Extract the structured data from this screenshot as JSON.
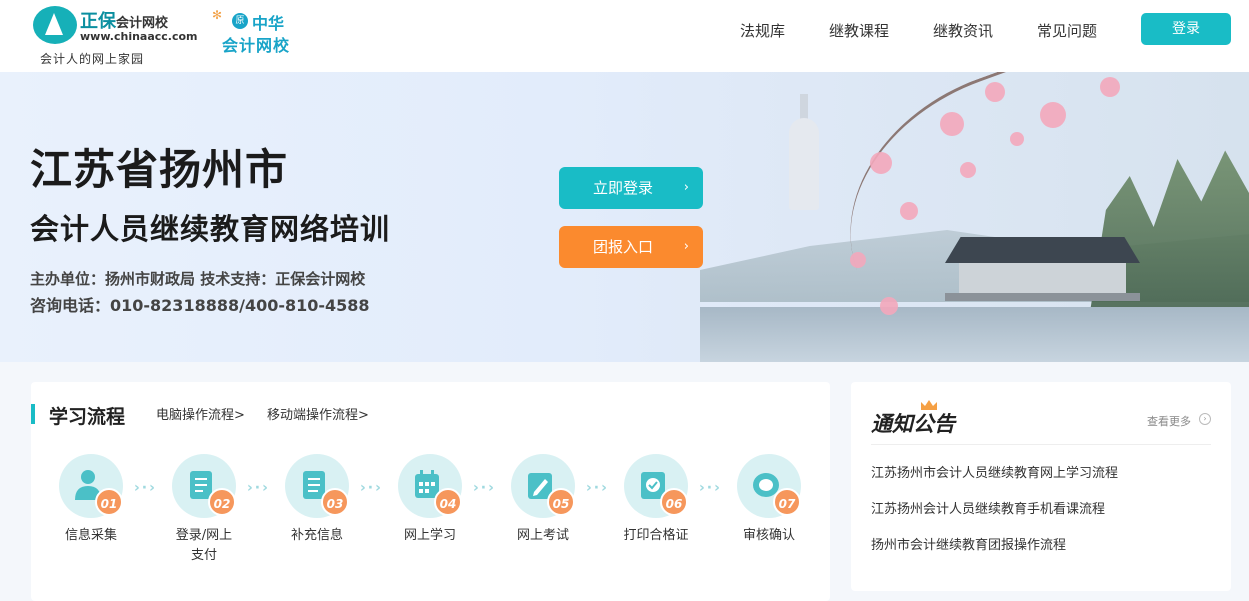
{
  "header": {
    "logo1": {
      "name": "正保",
      "name2": "会计网校",
      "url": "www.chinaacc.com",
      "slogan": "会计人的网上家园"
    },
    "logo2": {
      "badge": "原",
      "line1": "中华",
      "line2": "会计网校"
    },
    "nav": [
      "法规库",
      "继教课程",
      "继教资讯",
      "常见问题"
    ],
    "login_label": "登录"
  },
  "banner": {
    "title": "江苏省扬州市",
    "subtitle": "会计人员继续教育网络培训",
    "info1": "主办单位：扬州市财政局  技术支持：正保会计网校",
    "info2": "咨询电话：010-82318888/400-810-4588",
    "btn_login": "立即登录",
    "btn_group": "团报入口",
    "arrow": "›"
  },
  "process": {
    "title": "学习流程",
    "links": [
      "电脑操作流程>",
      "移动端操作流程>"
    ],
    "separator": "›·›",
    "steps": [
      {
        "num": "01",
        "label": "信息采集",
        "icon": "user-icon"
      },
      {
        "num": "02",
        "label": "登录/网上支付",
        "icon": "scroll-icon"
      },
      {
        "num": "03",
        "label": "补充信息",
        "icon": "document-icon"
      },
      {
        "num": "04",
        "label": "网上学习",
        "icon": "calendar-icon"
      },
      {
        "num": "05",
        "label": "网上考试",
        "icon": "edit-icon"
      },
      {
        "num": "06",
        "label": "打印合格证",
        "icon": "certificate-icon"
      },
      {
        "num": "07",
        "label": "审核确认",
        "icon": "review-icon"
      }
    ]
  },
  "notice": {
    "title": "通知公告",
    "more": "查看更多",
    "more_icon": "›",
    "items": [
      "江苏扬州市会计人员继续教育网上学习流程",
      "江苏扬州会计人员继续教育手机看课流程",
      "扬州市会计继续教育团报操作流程"
    ]
  },
  "colors": {
    "teal": "#19bcc6",
    "orange": "#fb8a2e",
    "step_circle": "#d9f1f3",
    "step_num": "#f6975c"
  }
}
